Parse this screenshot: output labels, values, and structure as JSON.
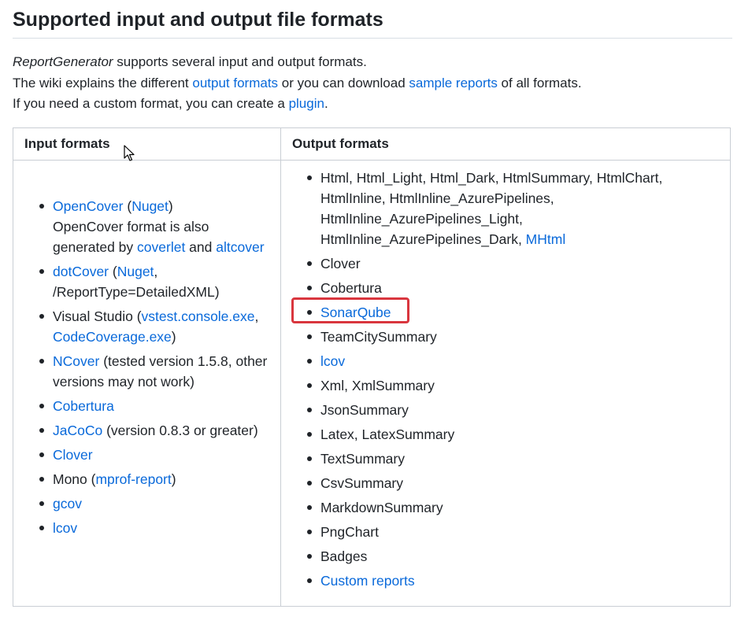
{
  "heading": "Supported input and output file formats",
  "intro": {
    "line1_em": "ReportGenerator",
    "line1_rest": " supports several input and output formats.",
    "line2_pre": "The wiki explains the different ",
    "line2_link1": "output formats",
    "line2_mid": " or you can download ",
    "line2_link2": "sample reports",
    "line2_post": " of all formats.",
    "line3_pre": "If you need a custom format, you can create a ",
    "line3_link": "plugin",
    "line3_post": "."
  },
  "table": {
    "input_header": "Input formats",
    "output_header": "Output formats",
    "input": {
      "opencover": {
        "link": "OpenCover",
        "open": " (",
        "nuget": "Nuget",
        "close": ")",
        "note": "OpenCover format is also generated by ",
        "coverlet": "coverlet",
        "and": " and ",
        "altcover": "altcover"
      },
      "dotcover": {
        "link": "dotCover",
        "open": " (",
        "nuget": "Nuget",
        "rest": ", /ReportType=DetailedXML)"
      },
      "visualstudio": {
        "text": "Visual Studio (",
        "link1": "vstest.console.exe",
        "sep": ", ",
        "link2": "CodeCoverage.exe",
        "close": ")"
      },
      "ncover": {
        "link": "NCover",
        "rest": " (tested version 1.5.8, other versions may not work)"
      },
      "cobertura": {
        "link": "Cobertura"
      },
      "jacoco": {
        "link": "JaCoCo",
        "rest": " (version 0.8.3 or greater)"
      },
      "clover": {
        "link": "Clover"
      },
      "mono": {
        "text": "Mono (",
        "link": "mprof-report",
        "close": ")"
      },
      "gcov": {
        "link": "gcov"
      },
      "lcov": {
        "link": "lcov"
      }
    },
    "output": {
      "html_text": "Html, Html_Light, Html_Dark, HtmlSummary, HtmlChart, HtmlInline, HtmlInline_AzurePipelines, HtmlInline_AzurePipelines_Light, HtmlInline_AzurePipelines_Dark, ",
      "mhtml": "MHtml",
      "clover": "Clover",
      "cobertura": "Cobertura",
      "sonarqube": "SonarQube",
      "teamcity": "TeamCitySummary",
      "lcov": "lcov",
      "xml": "Xml, XmlSummary",
      "json": "JsonSummary",
      "latex": "Latex, LatexSummary",
      "text": "TextSummary",
      "csv": "CsvSummary",
      "markdown": "MarkdownSummary",
      "png": "PngChart",
      "badges": "Badges",
      "custom": "Custom reports"
    }
  },
  "colors": {
    "link": "#0969da",
    "highlight": "#d9363e",
    "border": "#c9ced4"
  }
}
